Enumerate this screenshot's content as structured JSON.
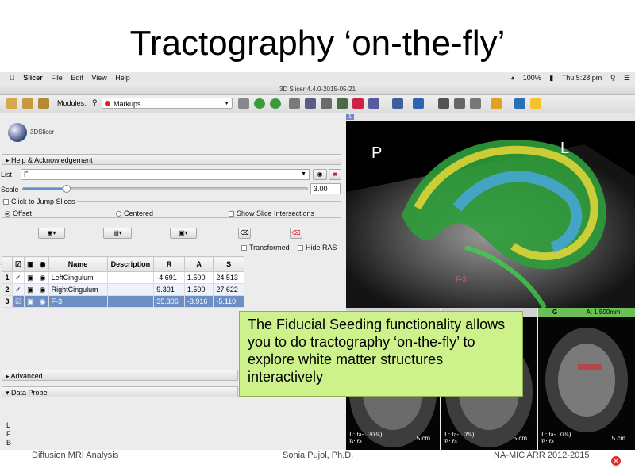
{
  "slide": {
    "title": "Tractography ‘on-the-fly’",
    "callout": "The Fiducial Seeding functionality allows you to do tractography ‘on-the-fly’ to explore white matter structures interactively",
    "footer_left": "Diffusion MRI Analysis",
    "footer_center": "Sonia Pujol, Ph.D.",
    "footer_right": "NA-MIC ARR 2012-2015"
  },
  "menubar": {
    "app": "Slicer",
    "items": [
      "File",
      "Edit",
      "View",
      "Help"
    ],
    "battery": "100%",
    "clock": "Thu 5:28 pm"
  },
  "window": {
    "title": "3D Slicer 4.4.0-2015-05-21"
  },
  "toolbar": {
    "modules_label": "Modules:",
    "module_selected": "Markups"
  },
  "panel": {
    "logo_text": "3DSlicer",
    "help_section": "Help & Acknowledgement",
    "list_label": "List",
    "list_value": "F",
    "scale_label": "Scale",
    "scale_value": "3.00",
    "scale_fraction": 0.15,
    "jump_slices_label": "Click to Jump Slices",
    "offset_label": "Offset",
    "centered_label": "Centered",
    "show_intersections_label": "Show Slice Intersections",
    "transformed_label": "Transformed",
    "hide_ras_label": "Hide RAS",
    "advanced_section": "Advanced",
    "data_probe_section": "Data Probe",
    "lfb": [
      "L",
      "F",
      "B"
    ]
  },
  "table": {
    "headers": [
      "Name",
      "Description",
      "R",
      "A",
      "S"
    ],
    "rows": [
      {
        "num": "1",
        "name": "LeftCingulum",
        "desc": "",
        "r": "-4.691",
        "a": "1.500",
        "s": "24.513"
      },
      {
        "num": "2",
        "name": "RightCingulum",
        "desc": "",
        "r": "9.301",
        "a": "1.500",
        "s": "27.622"
      },
      {
        "num": "3",
        "name": "F-3",
        "desc": "",
        "r": "35.306",
        "a": "-3.916",
        "s": "-5.110"
      }
    ]
  },
  "view3d": {
    "tab": "1",
    "orient_left": "P",
    "orient_right": "L",
    "fiducial_label": "F-3"
  },
  "slice_views": {
    "green_label": "G",
    "green_offset": "A: 1.500mm",
    "views": [
      {
        "lines": [
          "L: fa-...30%)",
          "B: fa"
        ],
        "scale": "5 cm"
      },
      {
        "lines": [
          "L: fa-...0%)",
          "B: fa"
        ],
        "scale": "5 cm"
      },
      {
        "lines": [
          "L: fa-...0%)",
          "B: fa"
        ],
        "scale": "5 cm"
      }
    ]
  },
  "colors": {
    "callout_bg": "#cdf28b",
    "selection": "#6e8fc3",
    "fiber_green": "#3ecf4a",
    "fiber_yellow": "#e8d93a",
    "fiber_blue": "#4aa8e6"
  }
}
